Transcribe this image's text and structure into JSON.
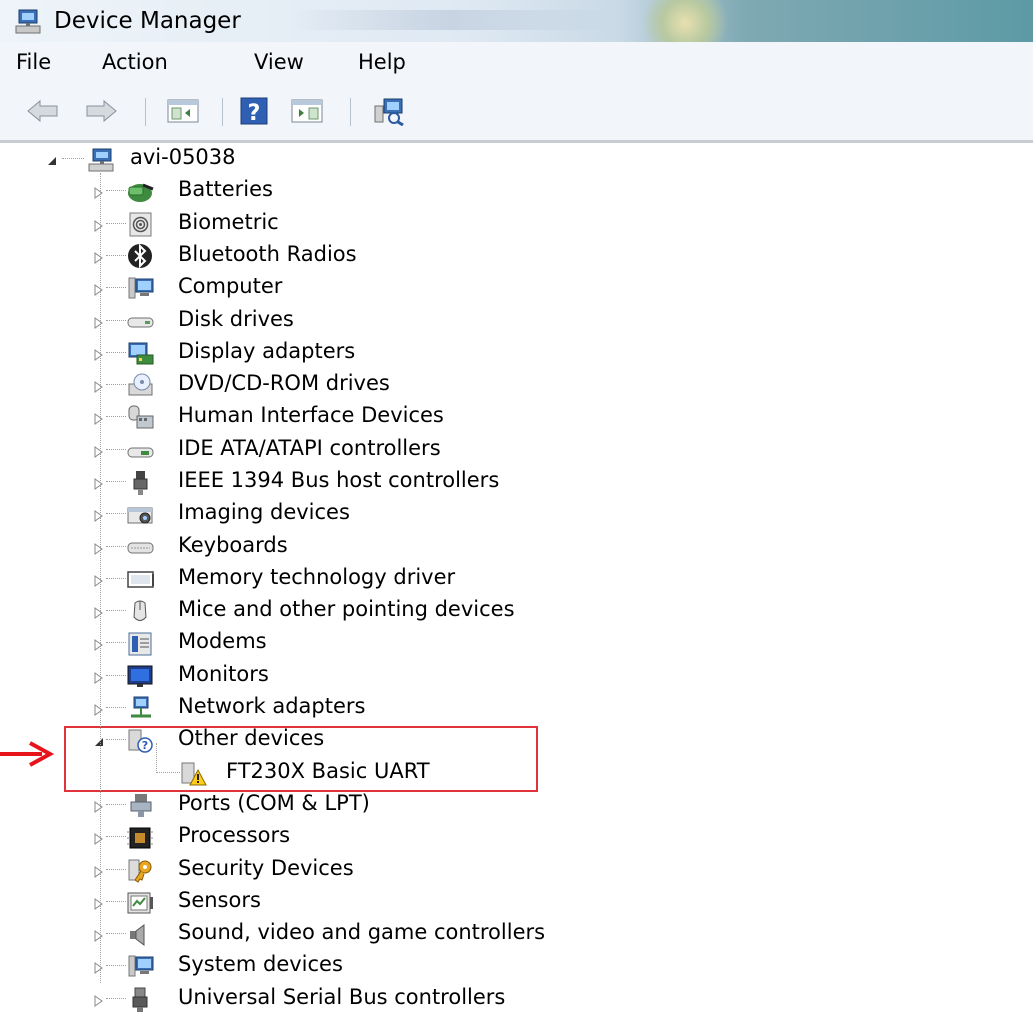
{
  "window": {
    "title": "Device Manager"
  },
  "menu": [
    "File",
    "Action",
    "View",
    "Help"
  ],
  "toolbar": {
    "buttons": [
      "back-icon",
      "forward-icon",
      "show-hide-console-tree-icon",
      "help-icon",
      "show-hide-action-pane-icon",
      "scan-hardware-changes-icon"
    ]
  },
  "tree": {
    "root": "avi-05038",
    "categories": [
      {
        "label": "Batteries",
        "icon": "battery-icon"
      },
      {
        "label": "Biometric",
        "icon": "fingerprint-icon"
      },
      {
        "label": "Bluetooth Radios",
        "icon": "bluetooth-icon"
      },
      {
        "label": "Computer",
        "icon": "computer-icon"
      },
      {
        "label": "Disk drives",
        "icon": "disk-drive-icon"
      },
      {
        "label": "Display adapters",
        "icon": "display-adapter-icon"
      },
      {
        "label": "DVD/CD-ROM drives",
        "icon": "dvd-drive-icon"
      },
      {
        "label": "Human Interface Devices",
        "icon": "hid-icon"
      },
      {
        "label": "IDE ATA/ATAPI controllers",
        "icon": "ide-controller-icon"
      },
      {
        "label": "IEEE 1394 Bus host controllers",
        "icon": "firewire-icon"
      },
      {
        "label": "Imaging devices",
        "icon": "camera-icon"
      },
      {
        "label": "Keyboards",
        "icon": "keyboard-icon"
      },
      {
        "label": "Memory technology driver",
        "icon": "memory-icon"
      },
      {
        "label": "Mice and other pointing devices",
        "icon": "mouse-icon"
      },
      {
        "label": "Modems",
        "icon": "modem-icon"
      },
      {
        "label": "Monitors",
        "icon": "monitor-icon"
      },
      {
        "label": "Network adapters",
        "icon": "network-adapter-icon"
      },
      {
        "label": "Other devices",
        "icon": "unknown-device-icon",
        "expanded": true,
        "children": [
          {
            "label": "FT230X Basic UART",
            "icon": "warning-device-icon"
          }
        ]
      },
      {
        "label": "Ports (COM & LPT)",
        "icon": "port-icon"
      },
      {
        "label": "Processors",
        "icon": "processor-icon"
      },
      {
        "label": "Security Devices",
        "icon": "key-icon"
      },
      {
        "label": "Sensors",
        "icon": "sensor-icon"
      },
      {
        "label": "Sound, video and game controllers",
        "icon": "speaker-icon"
      },
      {
        "label": "System devices",
        "icon": "system-devices-icon"
      },
      {
        "label": "Universal Serial Bus controllers",
        "icon": "usb-icon"
      }
    ]
  },
  "colors": {
    "highlight": "#e0333a",
    "arrow": "#e8141c"
  }
}
